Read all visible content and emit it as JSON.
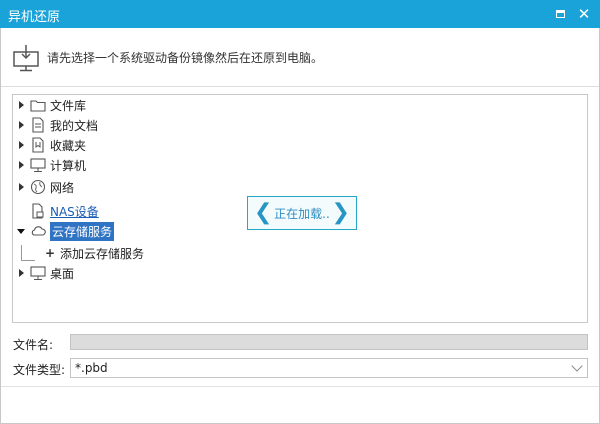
{
  "window": {
    "title": "异机还原"
  },
  "header": {
    "instruction": "请先选择一个系统驱动备份镜像然后在还原到电脑。"
  },
  "tree": {
    "items": [
      {
        "label": "文件库",
        "icon": "folder-icon",
        "expanded": false
      },
      {
        "label": "我的文档",
        "icon": "document-icon",
        "expanded": false
      },
      {
        "label": "收藏夹",
        "icon": "favorites-icon",
        "expanded": false
      },
      {
        "label": "计算机",
        "icon": "computer-icon",
        "expanded": false
      },
      {
        "label": "网络",
        "icon": "network-icon",
        "expanded": false
      },
      {
        "label": "NAS设备",
        "icon": "nas-icon",
        "expanded": false
      },
      {
        "label": "云存储服务",
        "icon": "cloud-icon",
        "expanded": true,
        "selected": true
      },
      {
        "label": "添加云存储服务",
        "icon": "plus-icon",
        "child": true
      },
      {
        "label": "桌面",
        "icon": "desktop-icon",
        "expanded": false
      }
    ]
  },
  "loading": {
    "text": "正在加载.."
  },
  "form": {
    "filename_label": "文件名:",
    "filename_value": "",
    "filetype_label": "文件类型:",
    "filetype_value": "*.pbd"
  }
}
